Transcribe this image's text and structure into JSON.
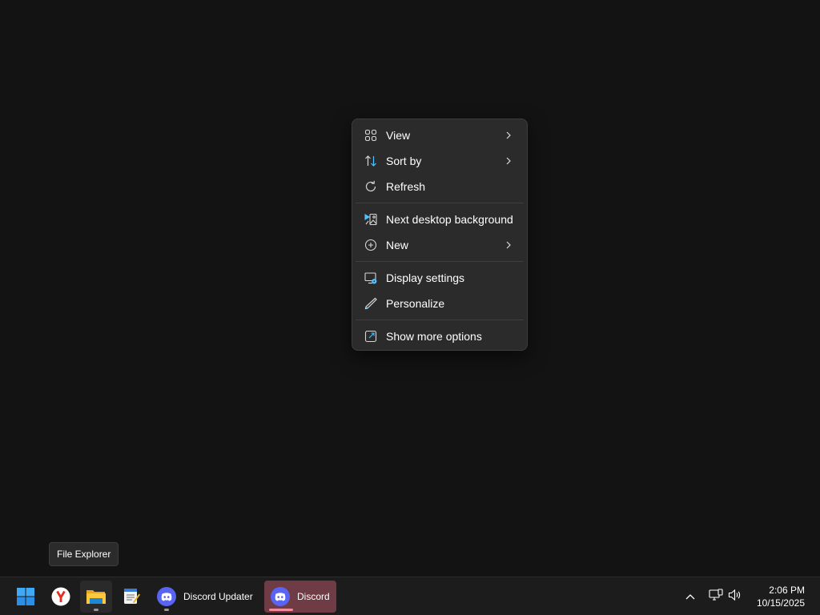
{
  "context_menu": {
    "items": [
      {
        "label": "View",
        "icon": "grid-view-icon",
        "submenu": true
      },
      {
        "label": "Sort by",
        "icon": "sort-arrows-icon",
        "submenu": true
      },
      {
        "label": "Refresh",
        "icon": "refresh-icon",
        "submenu": false
      },
      {
        "label": "Next desktop background",
        "icon": "next-background-icon",
        "submenu": false
      },
      {
        "label": "New",
        "icon": "plus-circle-icon",
        "submenu": true
      },
      {
        "label": "Display settings",
        "icon": "display-settings-icon",
        "submenu": false
      },
      {
        "label": "Personalize",
        "icon": "pen-icon",
        "submenu": false
      },
      {
        "label": "Show more options",
        "icon": "open-external-icon",
        "submenu": false
      }
    ]
  },
  "tooltip": {
    "text": "File Explorer"
  },
  "taskbar": {
    "apps": [
      {
        "name": "Start",
        "icon": "windows-start-icon"
      },
      {
        "name": "Yandex Browser",
        "icon": "yandex-browser-icon"
      },
      {
        "name": "File Explorer",
        "icon": "folder-icon",
        "active": true
      },
      {
        "name": "Notepad",
        "icon": "notepad-icon"
      },
      {
        "name": "Discord Updater",
        "label": "Discord Updater",
        "icon": "discord-icon"
      },
      {
        "name": "Discord",
        "label": "Discord",
        "icon": "discord-icon",
        "focused": true
      }
    ],
    "tray": {
      "icons": [
        "chevron-up-icon",
        "network-icon",
        "volume-icon"
      ],
      "time": "2:06 PM",
      "date": "10/15/2025"
    }
  },
  "colors": {
    "desktop_background": "#131313",
    "menu_background": "#2b2b2b",
    "taskbar_background": "#1c1c1c",
    "discord_focused": "#6f3b45",
    "accent_blue": "#4cc2ff"
  }
}
